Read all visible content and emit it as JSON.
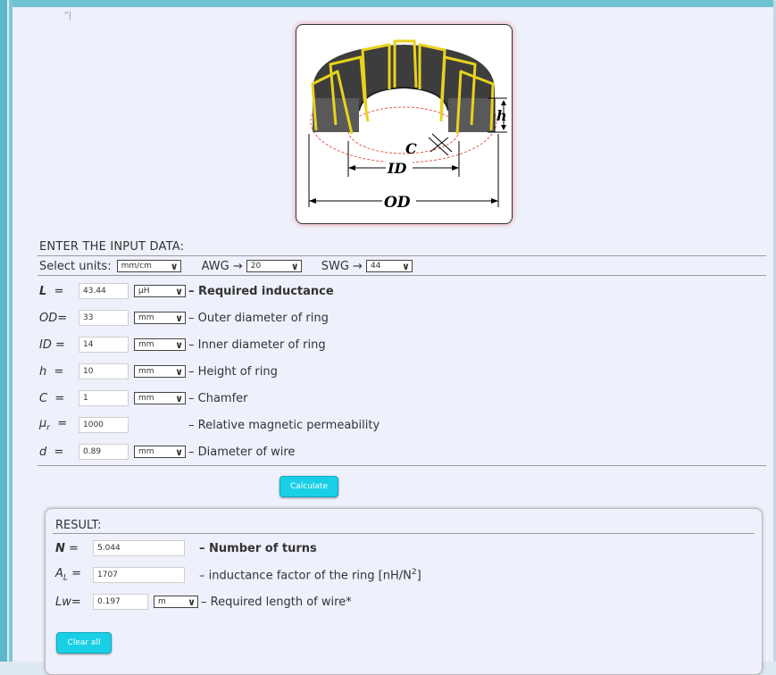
{
  "units": {
    "label": "Select units:",
    "value": "mm/cm",
    "awg_label": "AWG →",
    "awg_value": "20",
    "swg_label": "SWG →",
    "swg_value": "44"
  },
  "heading": "ENTER THE INPUT DATA:",
  "inputs": [
    {
      "sym": "L",
      "eq": "=",
      "value": "43.44",
      "unit": "μH",
      "desc": "– Required inductance",
      "bold": true
    },
    {
      "sym": "OD",
      "eq": "=",
      "value": "33",
      "unit": "mm",
      "desc": "– Outer diameter of ring"
    },
    {
      "sym": "ID",
      "eq": "=",
      "value": "14",
      "unit": "mm",
      "desc": "– Inner diameter of ring"
    },
    {
      "sym": "h",
      "eq": "=",
      "value": "10",
      "unit": "mm",
      "desc": "– Height of ring"
    },
    {
      "sym": "C",
      "eq": "=",
      "value": "1",
      "unit": "mm",
      "desc": "– Chamfer"
    },
    {
      "sym": "μ",
      "sub": "r",
      "eq": "=",
      "value": "1000",
      "unit": "",
      "desc": "– Relative magnetic permeability"
    },
    {
      "sym": "d",
      "eq": "=",
      "value": "0.89",
      "unit": "mm",
      "desc": "– Diameter of wire"
    }
  ],
  "buttons": {
    "calculate": "Calculate",
    "clear": "Clear all"
  },
  "result": {
    "heading": "RESULT:",
    "rows": [
      {
        "sym": "N",
        "eq": "=",
        "value": "5.044",
        "desc": "– Number of turns"
      },
      {
        "sym": "A",
        "sub": "L",
        "eq": "=",
        "value": "1707",
        "desc": "– inductance factor of the ring [nH/N",
        "sup": "2",
        "desc_end": "]"
      },
      {
        "sym": "Lw",
        "eq": "=",
        "value": "0.197",
        "unit": "m",
        "desc": "– Required length of wire*"
      }
    ]
  },
  "diagram": {
    "labels": {
      "h": "h",
      "c": "C",
      "id": "ID",
      "od": "OD"
    }
  },
  "colors": {
    "button": "#19cfe6",
    "accent_bg": "#6fc2cf",
    "panel": "#eef0fb"
  }
}
